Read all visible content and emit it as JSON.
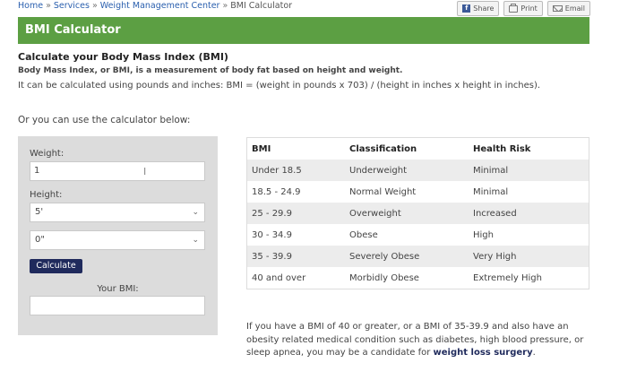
{
  "breadcrumb": {
    "items": [
      "Home",
      "Services",
      "Weight Management Center",
      "BMI Calculator"
    ],
    "separator": "»"
  },
  "toolbar": {
    "share_label": "Share",
    "print_label": "Print",
    "email_label": "Email"
  },
  "banner": {
    "title": "BMI Calculator"
  },
  "intro": {
    "heading": "Calculate your Body Mass Index (BMI)",
    "definition": "Body Mass Index, or BMI, is a measurement of body fat based on height and weight.",
    "formula": "It can be calculated using pounds and inches:  BMI = (weight in pounds x 703) / (height in inches x height in inches).",
    "calculator_prompt": "Or you can use the calculator below:"
  },
  "calculator": {
    "weight_label": "Weight:",
    "weight_value": "1",
    "height_label": "Height:",
    "height_feet": "5'",
    "height_inches": "0\"",
    "calculate_label": "Calculate",
    "bmi_label": "Your BMI:",
    "bmi_value": ""
  },
  "table": {
    "headers": [
      "BMI",
      "Classification",
      "Health Risk"
    ],
    "rows": [
      [
        "Under 18.5",
        "Underweight",
        "Minimal"
      ],
      [
        "18.5 - 24.9",
        "Normal Weight",
        "Minimal"
      ],
      [
        "25 - 29.9",
        "Overweight",
        "Increased"
      ],
      [
        "30 - 34.9",
        "Obese",
        "High"
      ],
      [
        "35 - 39.9",
        "Severely Obese",
        "Very High"
      ],
      [
        "40 and over",
        "Morbidly Obese",
        "Extremely High"
      ]
    ]
  },
  "note": {
    "text": "If you have a BMI of 40 or greater, or a BMI of 35-39.9 and also have an obesity related medical condition such as diabetes, high blood pressure, or sleep apnea, you may be a candidate for ",
    "link": "weight loss surgery",
    "end": "."
  },
  "colors": {
    "banner": "#5c9f43",
    "button": "#1f2a5c",
    "link": "#2a5fae"
  }
}
